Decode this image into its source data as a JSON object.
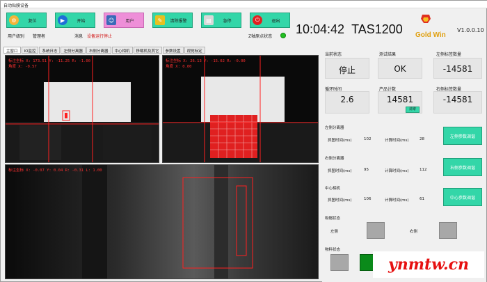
{
  "window": {
    "title": "自动贴膜设备"
  },
  "toolbar": [
    {
      "label": "复位",
      "icon": "reset-icon",
      "color": "#33d6a8"
    },
    {
      "label": "开始",
      "icon": "play-icon",
      "color": "#33d6a8"
    },
    {
      "label": "用户",
      "icon": "user-icon",
      "color": "#ee8fd8"
    },
    {
      "label": "清除报警",
      "icon": "broom-icon",
      "color": "#33d6a8"
    },
    {
      "label": "急停",
      "icon": "stop-icon",
      "color": "#33d6a8"
    },
    {
      "label": "退出",
      "icon": "power-icon",
      "color": "#33d6a8"
    }
  ],
  "header": {
    "user_level_label": "用户级别",
    "user_level_value": "管理者",
    "message_label": "消息",
    "message_value": "设备运行停止",
    "z_axis_label": "Z轴原点状态",
    "time": "10:04:42",
    "model": "TAS1200",
    "brand": "Gold Win",
    "version": "V1.0.0.10"
  },
  "tabs": [
    "主窗口",
    "IO监控",
    "系统日志",
    "左侧分离器",
    "右侧分离器",
    "中心相机",
    "移载机及其它",
    "参数设置",
    "视觉标定"
  ],
  "views": {
    "top_left_overlay_1": "标注坐标 X: 173.51 Y: -11.25 R: -1.00",
    "top_left_overlay_2": "角度 X: -0.57",
    "top_right_overlay_1": "标注坐标 X: 26.13 Y: -15.02 R: -0.00",
    "top_right_overlay_2": "角度 X: 0.00",
    "bottom_overlay": "标注坐标 X: -0.07 Y: 0.04 R: -0.31 L: 1.00"
  },
  "stats": {
    "status_label": "当前状态",
    "status_value": "停止",
    "test_result_label": "测试结果",
    "test_result_value": "OK",
    "left_label_count_label": "左侧标签数量",
    "left_label_count_value": "-14581",
    "cycle_time_label": "循环时间",
    "cycle_time_value": "2.6",
    "product_count_label": "产品计数",
    "product_count_value": "14581",
    "clear_button": "清零",
    "right_label_count_label": "右侧标签数量",
    "right_label_count_value": "-14581"
  },
  "left_separator": {
    "title": "左侧分离器",
    "grab_time_label": "抓图时间(ms)",
    "grab_time_value": "102",
    "calc_time_label": "计算时间(ms)",
    "calc_time_value": "28",
    "button": "左侧参数调谐"
  },
  "right_separator": {
    "title": "右侧分离器",
    "grab_time_label": "抓图时间(ms)",
    "grab_time_value": "95",
    "calc_time_label": "计算时间(ms)",
    "calc_time_value": "112",
    "button": "右侧参数调谐"
  },
  "center_camera": {
    "title": "中心相机",
    "grab_time_label": "抓图时间(ms)",
    "grab_time_value": "106",
    "calc_time_label": "计算时间(ms)",
    "calc_time_value": "61",
    "button": "中心参数调谐"
  },
  "suction_status": {
    "title": "吸帽状态",
    "left_label": "左侧",
    "right_label": "右侧"
  },
  "material_status": {
    "title": "物料状态"
  },
  "watermark": "ynmtw.cn"
}
